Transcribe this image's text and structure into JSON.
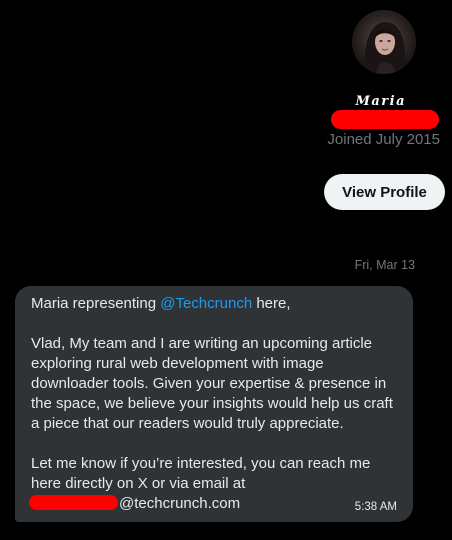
{
  "profile": {
    "display_name": "Maria",
    "joined": "Joined July 2015",
    "view_profile_label": "View Profile"
  },
  "conversation": {
    "date_separator": "Fri, Mar 13",
    "message": {
      "intro_prefix": "Maria representing ",
      "mention": "@Techcrunch",
      "intro_suffix": " here,",
      "paragraph_2": "Vlad, My team and I are writing an upcoming article exploring rural web development with image downloader tools. Given your expertise & presence in the space, we believe your insights would help us craft a piece that our readers would truly appreciate.",
      "paragraph_3": "Let me know if you’re interested, you can reach me here directly on X or via email at",
      "email_domain": "@techcrunch.com",
      "time": "5:38 AM"
    }
  },
  "colors": {
    "background": "#000000",
    "bubble": "#2f3336",
    "mention": "#1d9bf0",
    "muted_text": "#71767b",
    "redaction": "#ff0000",
    "button_bg": "#eff3f4"
  },
  "icons": {
    "avatar": "profile-photo"
  }
}
